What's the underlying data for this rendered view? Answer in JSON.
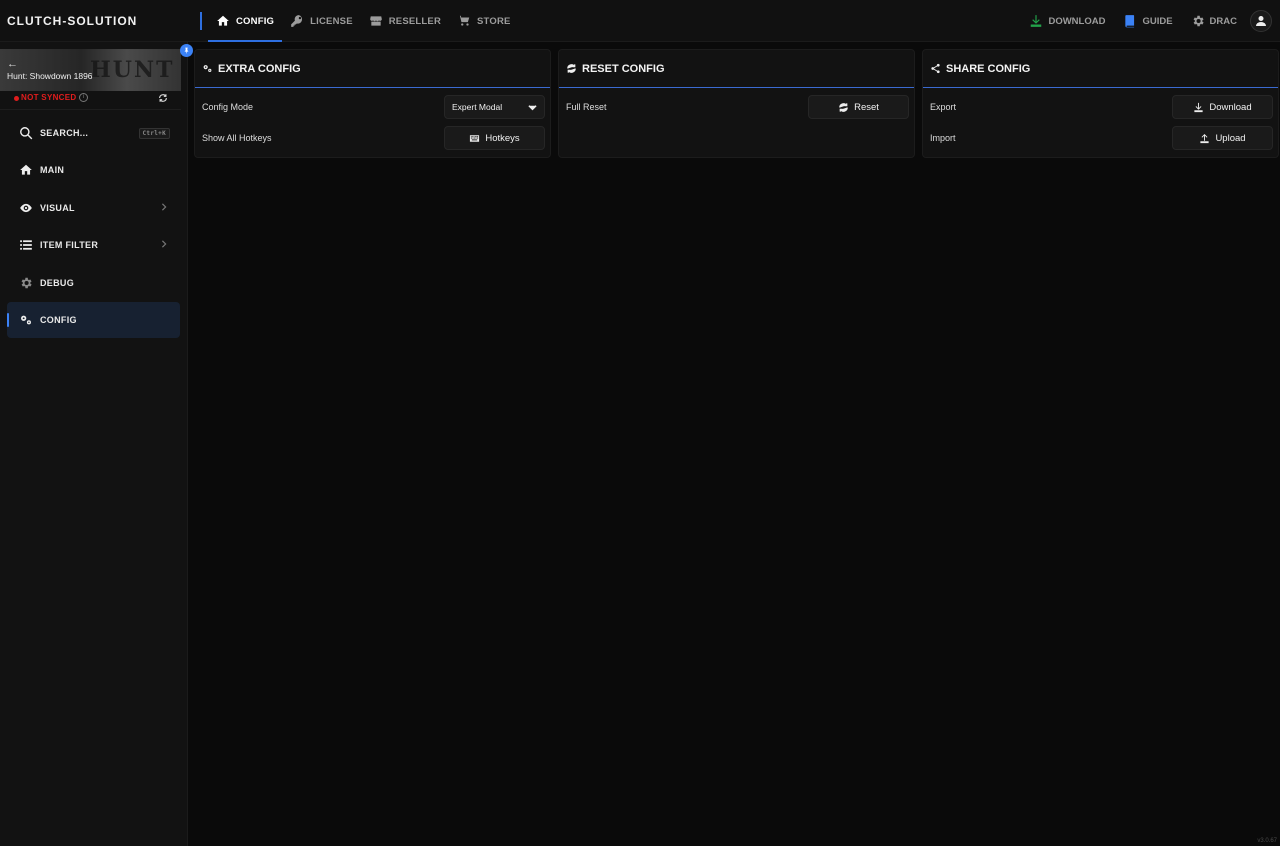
{
  "app": {
    "brand": "CLUTCH-SOLUTION",
    "version": "v3.0.67"
  },
  "nav": {
    "tabs": [
      {
        "label": "CONFIG",
        "icon": "home-icon",
        "active": true
      },
      {
        "label": "LICENSE",
        "icon": "key-icon",
        "active": false
      },
      {
        "label": "RESELLER",
        "icon": "store-icon",
        "active": false
      },
      {
        "label": "STORE",
        "icon": "cart-icon",
        "active": false
      }
    ],
    "download_label": "DOWNLOAD",
    "guide_label": "GUIDE",
    "user_label": "DRAC"
  },
  "sidebar": {
    "game_name": "Hunt: Showdown 1896",
    "banner_art": "HUNT",
    "sync_status": "NOT SYNCED",
    "search_label": "SEARCH...",
    "search_shortcut": "Ctrl+K",
    "items": [
      {
        "label": "MAIN",
        "icon": "home-icon"
      },
      {
        "label": "VISUAL",
        "icon": "eye-icon"
      },
      {
        "label": "ITEM FILTER",
        "icon": "list-icon"
      },
      {
        "label": "DEBUG",
        "icon": "gear-icon"
      },
      {
        "label": "CONFIG",
        "icon": "gears-icon"
      }
    ]
  },
  "panels": {
    "extra": {
      "title": "EXTRA CONFIG",
      "config_mode_label": "Config Mode",
      "config_mode_value": "Expert Modal",
      "hotkeys_label": "Show All Hotkeys",
      "hotkeys_button": "Hotkeys"
    },
    "reset": {
      "title": "RESET CONFIG",
      "full_reset_label": "Full Reset",
      "reset_button": "Reset"
    },
    "share": {
      "title": "SHARE CONFIG",
      "export_label": "Export",
      "download_button": "Download",
      "import_label": "Import",
      "upload_button": "Upload"
    }
  },
  "colors": {
    "accent": "#3b82f6",
    "not_synced": "#e11d1d",
    "download_icon": "#22a34a",
    "guide_icon": "#3b82f6"
  }
}
